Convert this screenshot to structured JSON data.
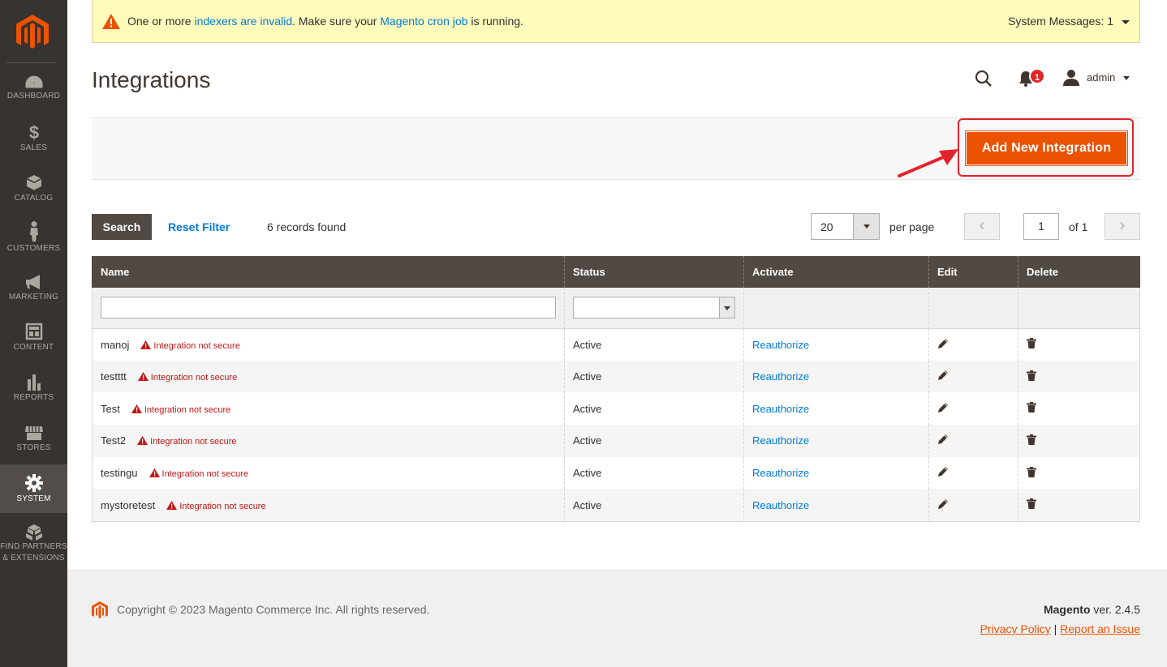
{
  "sidebar": {
    "items": [
      {
        "label": "DASHBOARD",
        "icon": "dashboard-icon"
      },
      {
        "label": "SALES",
        "icon": "dollar-icon"
      },
      {
        "label": "CATALOG",
        "icon": "cube-icon"
      },
      {
        "label": "CUSTOMERS",
        "icon": "person-icon"
      },
      {
        "label": "MARKETING",
        "icon": "megaphone-icon"
      },
      {
        "label": "CONTENT",
        "icon": "layout-icon"
      },
      {
        "label": "REPORTS",
        "icon": "bar-chart-icon"
      },
      {
        "label": "STORES",
        "icon": "store-icon"
      },
      {
        "label": "SYSTEM",
        "icon": "gear-icon",
        "active": true
      },
      {
        "label": "FIND PARTNERS",
        "label2": "& EXTENSIONS",
        "icon": "boxes-icon"
      }
    ]
  },
  "notice": {
    "pre": "One or more ",
    "link1": "indexers are invalid",
    "mid": ". Make sure your ",
    "link2": "Magento cron job",
    "post": " is running.",
    "system_messages": "System Messages: 1"
  },
  "header": {
    "title": "Integrations",
    "notification_count": "1",
    "user": "admin"
  },
  "actions": {
    "add_new": "Add New Integration"
  },
  "toolbar": {
    "search": "Search",
    "reset": "Reset Filter",
    "records": "6 records found",
    "per_page_value": "20",
    "per_page_label": "per page",
    "page": "1",
    "of_pages": "of 1",
    "prev": "‹",
    "next": "›"
  },
  "grid": {
    "columns": [
      "Name",
      "Status",
      "Activate",
      "Edit",
      "Delete"
    ],
    "rows": [
      {
        "name": "manoj",
        "warning": "Integration not secure",
        "status": "Active",
        "activate": "Reauthorize"
      },
      {
        "name": "testttt",
        "warning": "Integration not secure",
        "status": "Active",
        "activate": "Reauthorize"
      },
      {
        "name": "Test",
        "warning": "Integration not secure",
        "status": "Active",
        "activate": "Reauthorize"
      },
      {
        "name": "Test2",
        "warning": "Integration not secure",
        "status": "Active",
        "activate": "Reauthorize"
      },
      {
        "name": "testingu",
        "warning": "Integration not secure",
        "status": "Active",
        "activate": "Reauthorize"
      },
      {
        "name": "mystoretest",
        "warning": "Integration not secure",
        "status": "Active",
        "activate": "Reauthorize"
      }
    ]
  },
  "footer": {
    "copyright": "Copyright © 2023 Magento Commerce Inc. All rights reserved.",
    "brand": "Magento",
    "version": " ver. 2.4.5",
    "privacy": "Privacy Policy",
    "separator": " | ",
    "report": "Report an Issue"
  },
  "colors": {
    "sidebar": "#373330",
    "accent": "#eb5202",
    "link": "#007bdb",
    "grid_header": "#514943",
    "warning": "#c41616"
  }
}
